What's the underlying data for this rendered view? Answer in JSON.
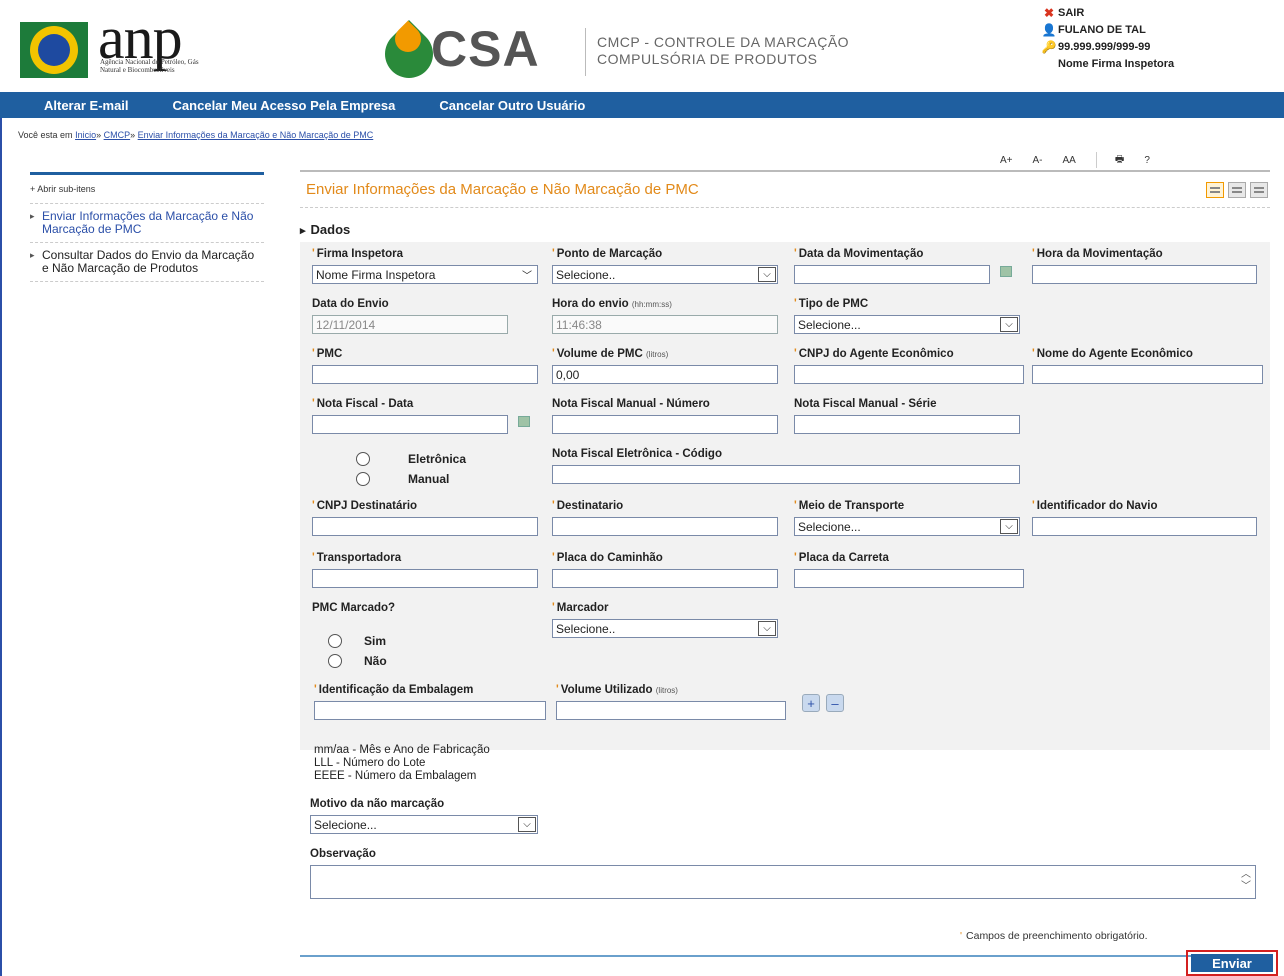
{
  "header": {
    "anp_logo_text": "anp",
    "anp_logo_sub": "Agência Nacional do Petróleo, Gás Natural e Biocombustíveis",
    "csa_logo_text": "CSA",
    "csa_desc_line1": "CMCP - CONTROLE DA MARCAÇÃO",
    "csa_desc_line2": "COMPULSÓRIA DE PRODUTOS",
    "logout": "SAIR",
    "user_name": "FULANO DE TAL",
    "user_cnpj": "99.999.999/999-99",
    "user_firm": "Nome Firma Inspetora"
  },
  "nav": {
    "items": [
      "Alterar E-mail",
      "Cancelar Meu Acesso Pela Empresa",
      "Cancelar Outro Usuário"
    ]
  },
  "breadcrumb": {
    "prefix": "Você esta em",
    "items": [
      "Inicio",
      "CMCP",
      "Enviar Informações da Marcação e Não Marcação de PMC"
    ],
    "sep": "»"
  },
  "toolbar": {
    "font_up": "A+",
    "font_down": "A-",
    "font_reset": "AA",
    "help": "?"
  },
  "sidebar": {
    "toggle": "+ Abrir sub-itens",
    "items": [
      "Enviar Informações da Marcação e Não Marcação de PMC",
      "Consultar Dados do Envio da Marcação e Não Marcação de Produtos"
    ]
  },
  "page": {
    "title": "Enviar Informações da Marcação e Não Marcação de PMC",
    "section": "Dados"
  },
  "form": {
    "firma": {
      "label": "Firma Inspetora",
      "value": "Nome Firma Inspetora"
    },
    "ponto": {
      "label": "Ponto de Marcação",
      "value": "Selecione.."
    },
    "data_mov": {
      "label": "Data da Movimentação",
      "value": ""
    },
    "hora_mov": {
      "label": "Hora da Movimentação",
      "value": ""
    },
    "data_envio": {
      "label": "Data do Envio",
      "value": "12/11/2014"
    },
    "hora_envio": {
      "label": "Hora do envio",
      "unit": "(hh:mm:ss)",
      "value": "11:46:38"
    },
    "tipo_pmc": {
      "label": "Tipo de PMC",
      "value": "Selecione..."
    },
    "pmc": {
      "label": "PMC",
      "value": ""
    },
    "volume_pmc": {
      "label": "Volume de PMC",
      "unit": "(litros)",
      "value": "0,00"
    },
    "cnpj_agente": {
      "label": "CNPJ do Agente Econômico",
      "value": ""
    },
    "nome_agente": {
      "label": "Nome do Agente Econômico",
      "value": ""
    },
    "nf_data": {
      "label": "Nota Fiscal - Data",
      "value": ""
    },
    "nf_manual_num": {
      "label": "Nota Fiscal Manual - Número",
      "value": ""
    },
    "nf_manual_serie": {
      "label": "Nota Fiscal Manual - Série",
      "value": ""
    },
    "nf_tipo_eletronica": "Eletrônica",
    "nf_tipo_manual": "Manual",
    "nf_eletronica_cod": {
      "label": "Nota Fiscal Eletrônica - Código",
      "value": ""
    },
    "cnpj_dest": {
      "label": "CNPJ Destinatário",
      "value": ""
    },
    "destinatario": {
      "label": "Destinatario",
      "value": ""
    },
    "meio_transp": {
      "label": "Meio de Transporte",
      "value": "Selecione..."
    },
    "id_navio": {
      "label": "Identificador do Navio",
      "value": ""
    },
    "transportadora": {
      "label": "Transportadora",
      "value": ""
    },
    "placa_caminhao": {
      "label": "Placa do Caminhão",
      "value": ""
    },
    "placa_carreta": {
      "label": "Placa da Carreta",
      "value": ""
    },
    "pmc_marcado": {
      "label": "PMC Marcado?",
      "sim": "Sim",
      "nao": "Não"
    },
    "marcador": {
      "label": "Marcador",
      "value": "Selecione.."
    },
    "id_embalagem": {
      "label": "Identificação da Embalagem",
      "value": ""
    },
    "volume_utilizado": {
      "label": "Volume Utilizado",
      "unit": "(litros)",
      "value": ""
    },
    "add": "+",
    "remove": "–",
    "legend": [
      "mm/aa - Mês e Ano de Fabricação",
      "LLL - Número do Lote",
      "EEEE - Número da Embalagem"
    ],
    "motivo": {
      "label": "Motivo da não marcação",
      "value": "Selecione..."
    },
    "observacao": {
      "label": "Observação",
      "value": ""
    }
  },
  "footer": {
    "required_note": "Campos de preenchimento obrigatório.",
    "submit": "Enviar"
  },
  "colors": {
    "nav_bg": "#1f5fa0",
    "title": "#e28a1a",
    "required": "#e28a1a",
    "highlight": "#d32020"
  }
}
